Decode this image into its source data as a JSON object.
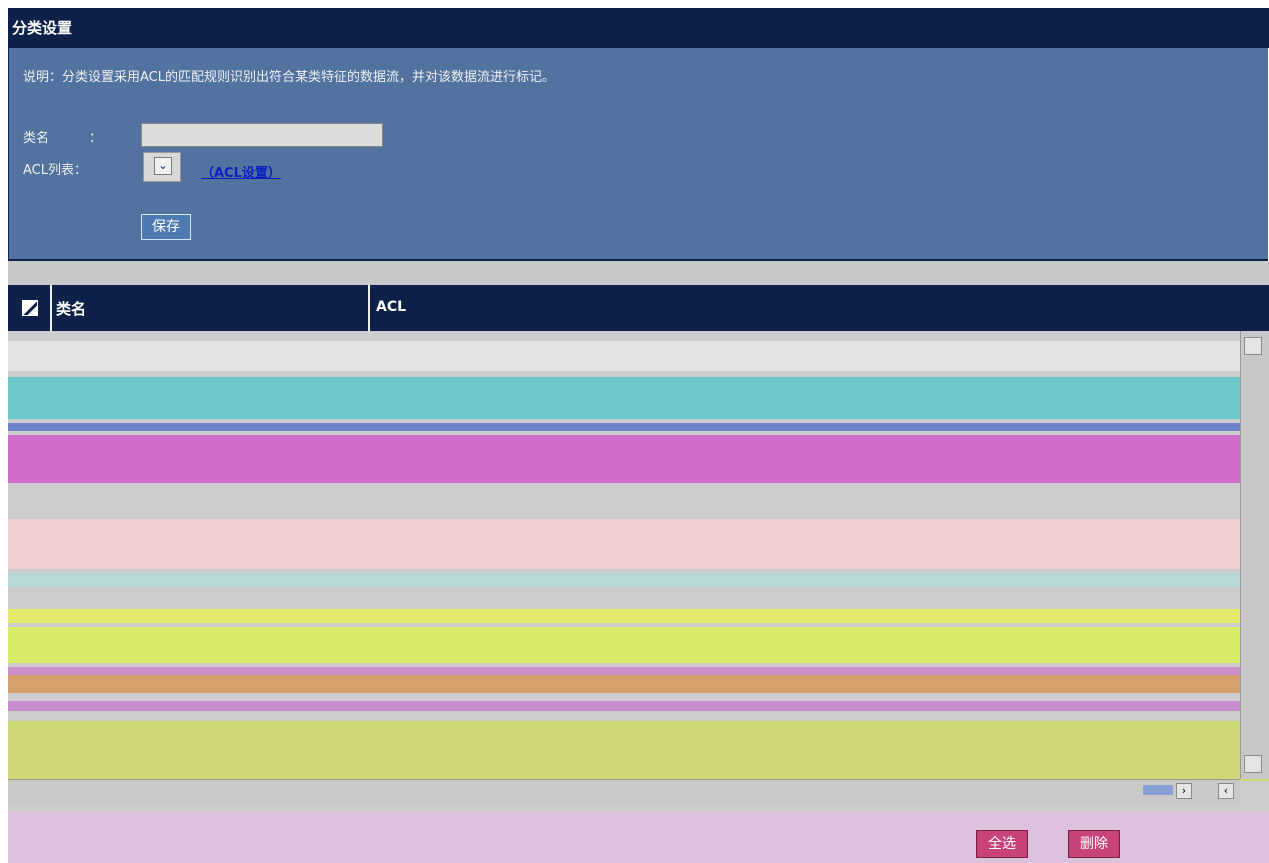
{
  "panel": {
    "title": "分类设置",
    "description": "说明：分类设置采用ACL的匹配规则识别出符合某类特征的数据流，并对该数据流进行标记。",
    "name_label": "类名",
    "name_colon": "：",
    "name_value": "",
    "acl_label": "ACL列表：",
    "acl_selected": "",
    "acl_link": "（ACL设置）",
    "save_button": "保存"
  },
  "table": {
    "columns": [
      "类名",
      "ACL"
    ],
    "rows": []
  },
  "footer": {
    "select_all": "全选",
    "delete": "删除"
  },
  "colors": {
    "header_bg": "#0d2149",
    "panel_bg": "#52739f",
    "link": "#0a1fbf",
    "footer_bg": "#dcc1dc",
    "footer_button": "#c8437a"
  },
  "icons": {
    "select_arrow": "chevron-down-icon",
    "header_checkbox": "check-all-icon",
    "scroll_up": "arrow-up-icon",
    "scroll_down": "arrow-down-icon",
    "scroll_left": "arrow-left-icon",
    "scroll_right": "arrow-right-icon"
  }
}
